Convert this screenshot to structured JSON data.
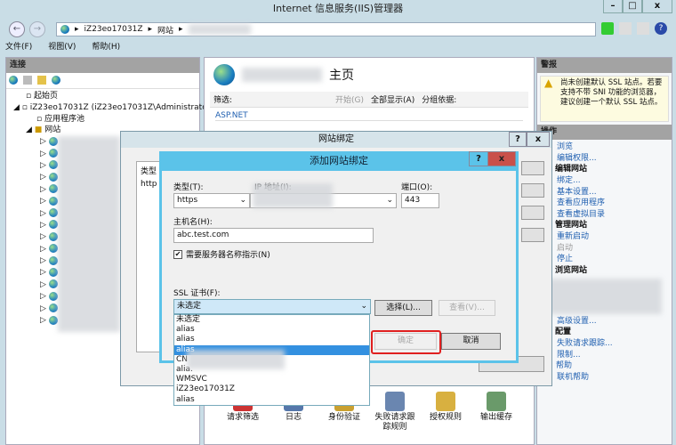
{
  "window": {
    "title": "Internet 信息服务(IIS)管理器",
    "minimize": "–",
    "maximize": "□",
    "close": "x"
  },
  "address": {
    "segments": [
      "iZ23eo17031Z",
      "网站"
    ]
  },
  "menu": [
    "文件(F)",
    "视图(V)",
    "帮助(H)"
  ],
  "connections": {
    "header": "连接",
    "tree": {
      "start": "起始页",
      "server": "iZ23eo17031Z (iZ23eo17031Z\\Administrator",
      "apppools": "应用程序池",
      "sites": "网站"
    }
  },
  "center": {
    "title_suffix": "主页",
    "filter_label": "筛选:",
    "start_btn": "开始(G)",
    "show_all": "全部显示(A)",
    "group_by": "分组依据:",
    "group": "ASP.NET",
    "features": [
      "请求筛选",
      "日志",
      "身份验证",
      "失败请求跟踪规则",
      "授权规则",
      "输出缓存"
    ]
  },
  "alerts": {
    "header": "警报",
    "text": "尚未创建默认 SSL 站点。若要支持不带 SNI 功能的浏览器，建议创建一个默认 SSL 站点。"
  },
  "actions": {
    "header": "操作",
    "items": [
      {
        "type": "link",
        "label": "浏览"
      },
      {
        "type": "link",
        "label": "编辑权限..."
      },
      {
        "type": "section",
        "label": "编辑网站"
      },
      {
        "type": "link",
        "label": "绑定..."
      },
      {
        "type": "link",
        "label": "基本设置..."
      },
      {
        "type": "link",
        "label": "查看应用程序"
      },
      {
        "type": "link",
        "label": "查看虚拟目录"
      },
      {
        "type": "section",
        "label": "管理网站"
      },
      {
        "type": "link",
        "label": "重新启动"
      },
      {
        "type": "disabled",
        "label": "启动"
      },
      {
        "type": "link",
        "label": "停止"
      },
      {
        "type": "section",
        "label": "浏览网站"
      }
    ],
    "items2": [
      {
        "type": "link",
        "label": "高级设置..."
      },
      {
        "type": "section",
        "label": "配置"
      },
      {
        "type": "link",
        "label": "失败请求跟踪..."
      },
      {
        "type": "link",
        "label": "限制..."
      },
      {
        "type": "help",
        "label": "帮助"
      },
      {
        "type": "link",
        "label": "联机帮助"
      }
    ]
  },
  "bindings_dialog": {
    "title": "网站绑定",
    "help": "?",
    "close": "x",
    "col_type": "类型",
    "row_type": "http"
  },
  "add_dialog": {
    "title": "添加网站绑定",
    "help": "?",
    "close": "x",
    "type_label": "类型(T):",
    "type_value": "https",
    "ip_label": "IP 地址(I):",
    "port_label": "端口(O):",
    "port_value": "443",
    "host_label": "主机名(H):",
    "host_value": "abc.test.com",
    "sni_label": "需要服务器名称指示(N)",
    "sni_checked": true,
    "ssl_label": "SSL 证书(F):",
    "ssl_value": "未选定",
    "ssl_options": [
      "未选定",
      "alias",
      "alias",
      "alias",
      "CN",
      "alia.",
      "WMSVC",
      "iZ23eo17031Z",
      "alias"
    ],
    "select_btn": "选择(L)...",
    "view_btn": "查看(V)...",
    "ok_btn": "确定",
    "cancel_btn": "取消"
  },
  "colors": {
    "accent": "#5bc3e9",
    "highlight": "#3390e0",
    "ok_outline": "#e02020"
  }
}
